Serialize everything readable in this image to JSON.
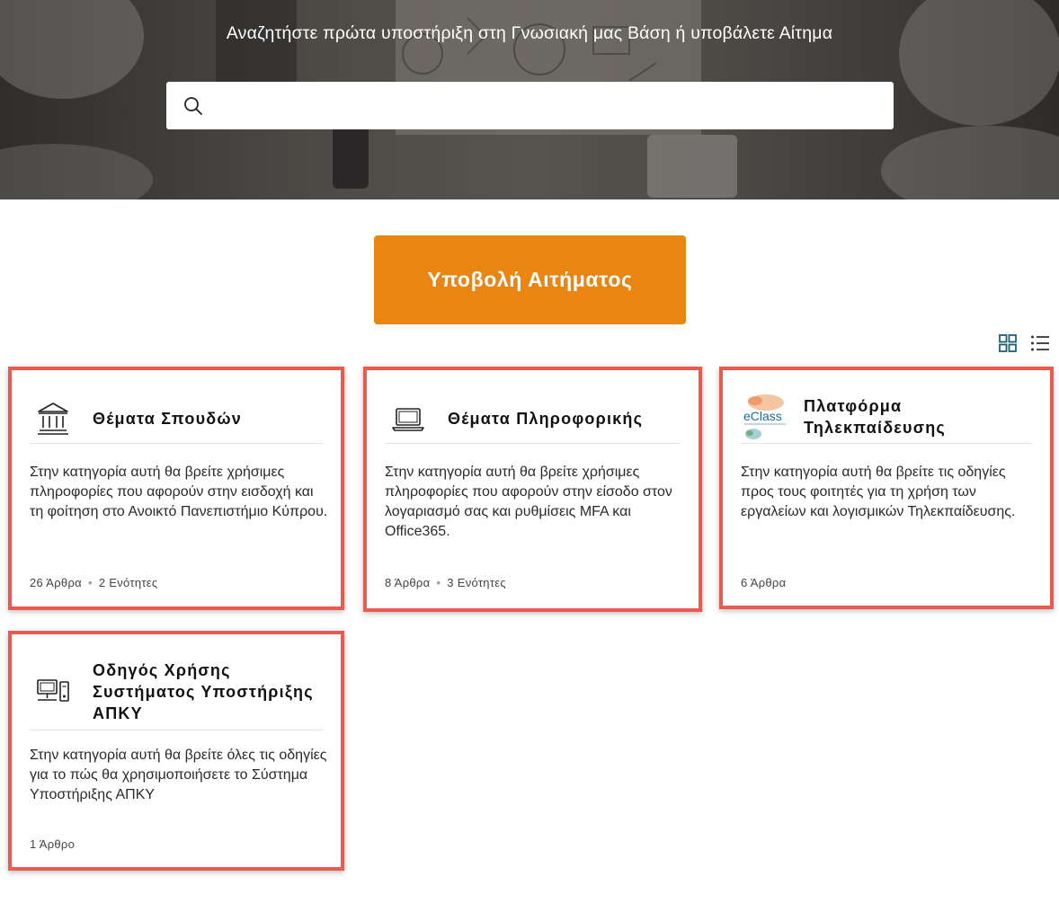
{
  "hero": {
    "title": "Αναζητήστε πρώτα υποστήριξη στη Γνωσιακή μας Βάση ή υποβάλετε Αίτημα",
    "search": {
      "placeholder": "",
      "value": ""
    }
  },
  "actions": {
    "submit_label": "Υποβολή Αιτήματος"
  },
  "view_toggle": {
    "options": [
      "grid-view",
      "list-view"
    ],
    "selected": "grid-view"
  },
  "colors": {
    "accent": "#e98511",
    "card_highlight": "#ea5a4f",
    "toggle_active": "#1f5f73"
  },
  "categories": [
    {
      "icon": "institution-icon",
      "title": "Θέματα Σπουδών",
      "description": "Στην κατηγορία αυτή θα βρείτε χρήσιμες πληροφορίες που αφορούν στην εισδοχή και τη φοίτηση στο Ανοικτό Πανεπιστήμιο Κύπρου.",
      "articles": "26 Άρθρα",
      "sections": "2 Ενότητες"
    },
    {
      "icon": "laptop-icon",
      "title": "Θέματα Πληροφορικής",
      "description": "Στην κατηγορία αυτή θα βρείτε χρήσιμες πληροφορίες που αφορούν στην είσοδο στον λογαριασμό σας και ρυθμίσεις MFA και Office365.",
      "articles": "8 Άρθρα",
      "sections": "3 Ενότητες"
    },
    {
      "icon": "eclass-logo-icon",
      "logo_text": "eClass",
      "title": "Πλατφόρμα Τηλεκπαίδευσης",
      "description": "Στην κατηγορία αυτή θα βρείτε τις οδηγίες προς τους φοιτητές για τη χρήση των εργαλείων και λογισμικών Τηλεκπαίδευσης.",
      "articles": "6 Άρθρα"
    },
    {
      "icon": "desktop-computer-icon",
      "title": "Οδηγός Χρήσης Συστήματος Υποστήριξης ΑΠΚΥ",
      "description": "Στην κατηγορία αυτή θα βρείτε όλες τις οδηγίες για το πώς θα χρησιμοποιήσετε το Σύστημα Υποστήριξης ΑΠΚΥ",
      "articles": "1 Άρθρο"
    }
  ]
}
